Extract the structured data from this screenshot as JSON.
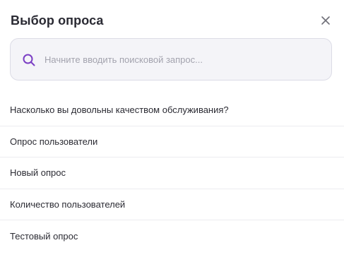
{
  "dialog": {
    "title": "Выбор опроса",
    "close_icon": "close-icon"
  },
  "search": {
    "icon": "search-icon",
    "placeholder": "Начните вводить поисковой запрос...",
    "value": "",
    "icon_color": "#7b3fc4"
  },
  "surveys": [
    {
      "label": "Насколько вы довольны качеством обслуживания?"
    },
    {
      "label": "Опрос пользователи"
    },
    {
      "label": "Новый опрос"
    },
    {
      "label": "Количество пользователей"
    },
    {
      "label": "Тестовый опрос"
    }
  ]
}
